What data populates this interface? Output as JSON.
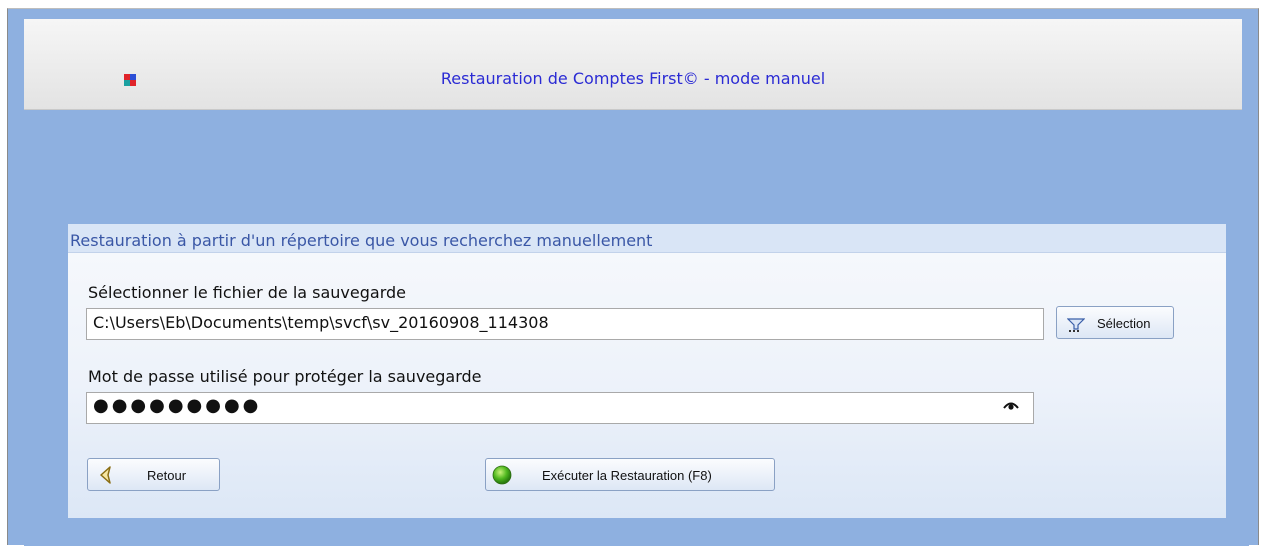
{
  "header": {
    "title": "Restauration de Comptes First© - mode manuel",
    "logo_colors": [
      "#e0242a",
      "#2c4fd6",
      "#1aa0a0",
      "#e0242a"
    ]
  },
  "panel": {
    "title": "Restauration à partir d'un répertoire que vous recherchez manuellement",
    "file_label": "Sélectionner le fichier de la sauvegarde",
    "file_value": "C:\\Users\\Eb\\Documents\\temp\\svcf\\sv_20160908_114308",
    "selection_button": "Sélection",
    "password_label": "Mot de passe utilisé pour protéger la sauvegarde",
    "password_value": "●●●●●●●●●",
    "back_button": "Retour",
    "execute_button": "Exécuter la Restauration (F8)"
  }
}
